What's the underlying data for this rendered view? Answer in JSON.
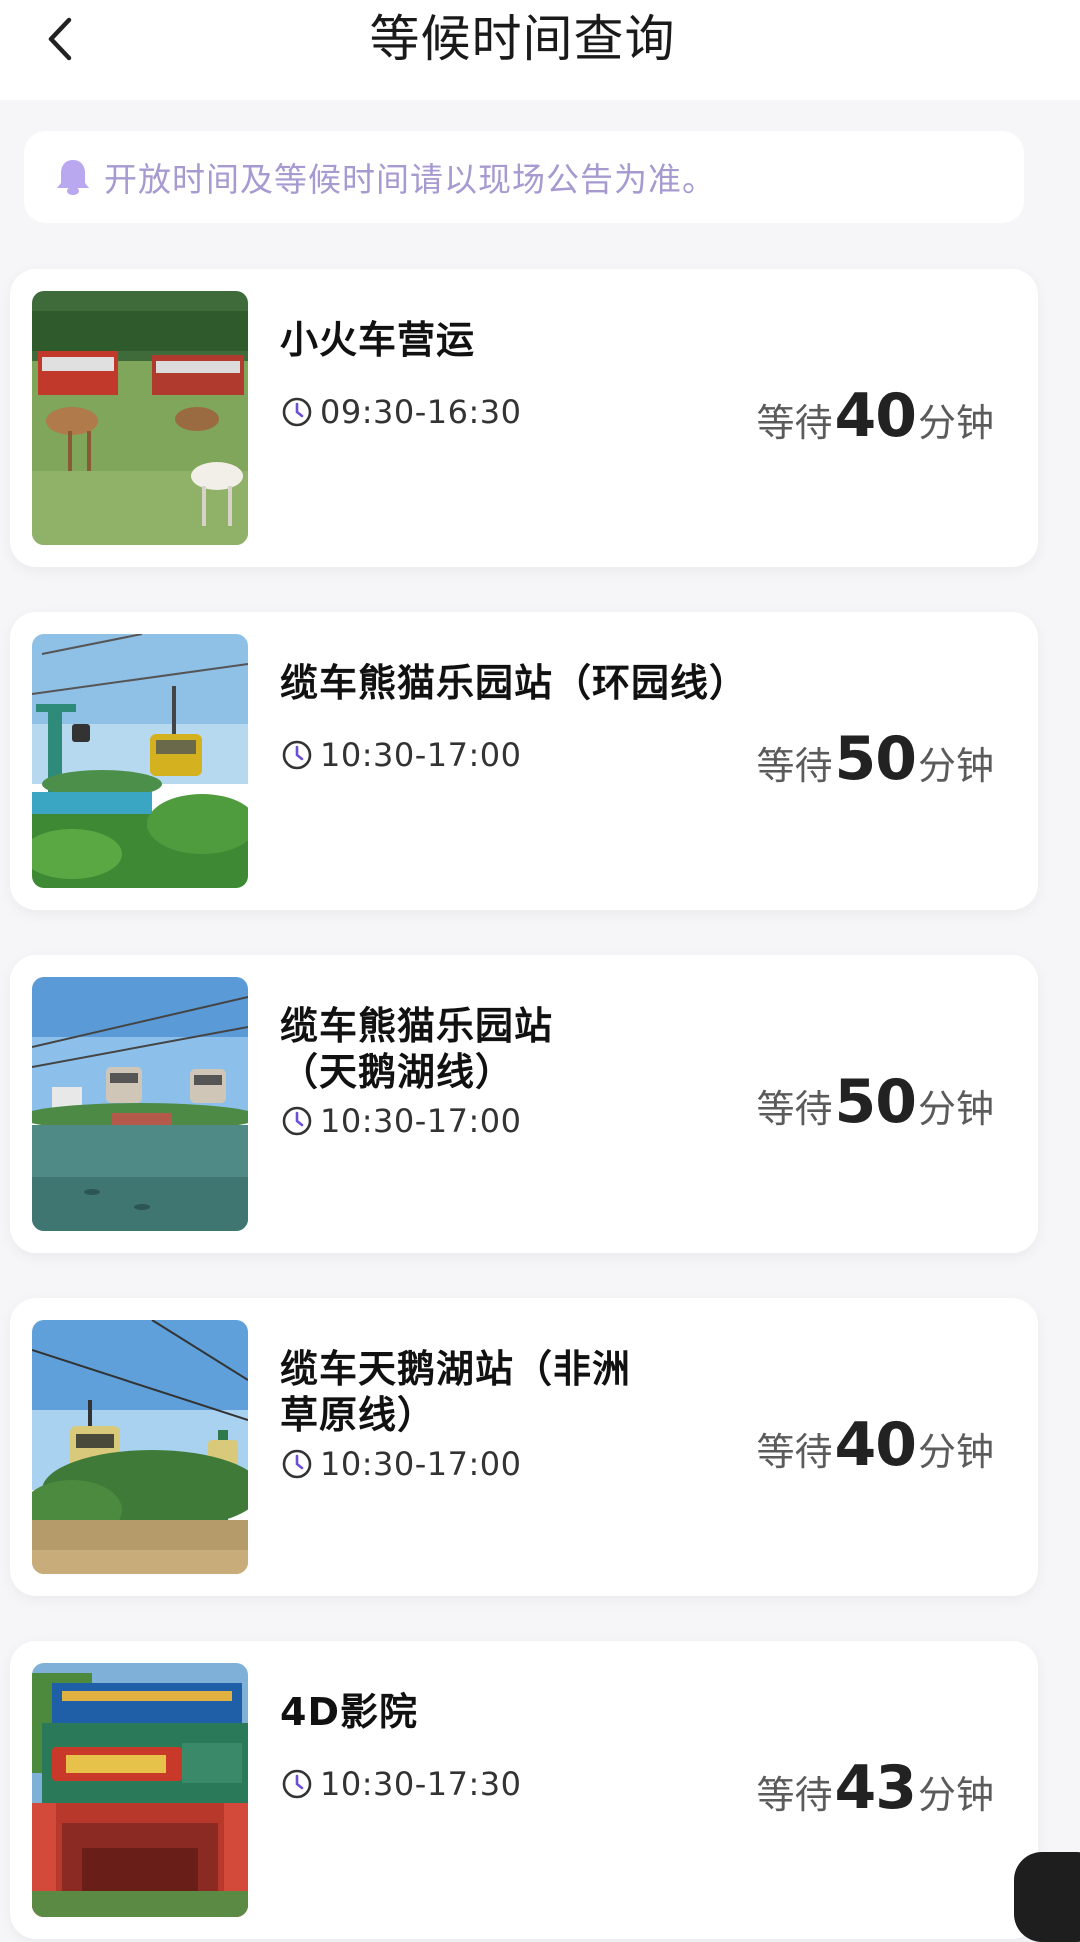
{
  "header": {
    "title": "等候时间查询"
  },
  "notice": {
    "text": "开放时间及等候时间请以现场公告为准。",
    "icon": "bell-icon",
    "color": "#a69ad0"
  },
  "rides": [
    {
      "name": "小火车营运",
      "hours": "09:30-16:30",
      "wait_prefix": "等待",
      "wait_minutes": "40",
      "wait_suffix": "分钟",
      "thumbnail": "safari-train-photo"
    },
    {
      "name": "缆车熊猫乐园站（环园线）",
      "hours": "10:30-17:00",
      "wait_prefix": "等待",
      "wait_minutes": "50",
      "wait_suffix": "分钟",
      "thumbnail": "cable-car-photo"
    },
    {
      "name": "缆车熊猫乐园站\n（天鹅湖线）",
      "hours": "10:30-17:00",
      "wait_prefix": "等待",
      "wait_minutes": "50",
      "wait_suffix": "分钟",
      "thumbnail": "cable-car-lake-photo"
    },
    {
      "name": "缆车天鹅湖站（非洲\n草原线）",
      "hours": "10:30-17:00",
      "wait_prefix": "等待",
      "wait_minutes": "40",
      "wait_suffix": "分钟",
      "thumbnail": "cable-car-forest-photo"
    },
    {
      "name": "4D影院",
      "hours": "10:30-17:30",
      "wait_prefix": "等待",
      "wait_minutes": "43",
      "wait_suffix": "分钟",
      "thumbnail": "4d-theater-photo"
    }
  ]
}
